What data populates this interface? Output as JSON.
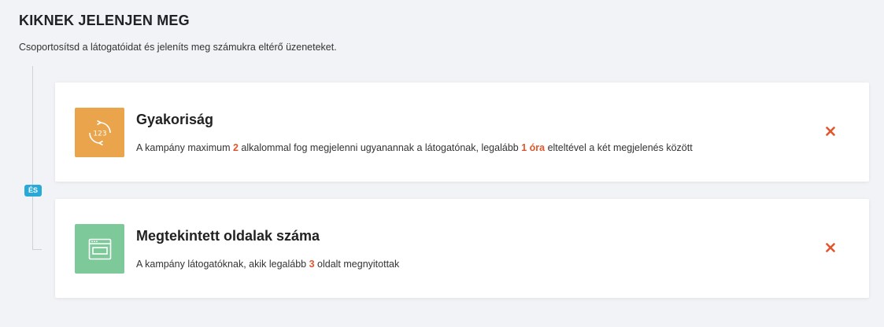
{
  "page": {
    "title": "KIKNEK JELENJEN MEG",
    "subtitle": "Csoportosítsd a látogatóidat és jeleníts meg számukra eltérő üzeneteket."
  },
  "connector": {
    "and_label": "ÉS"
  },
  "colors": {
    "accent": "#e2552d",
    "frequency_icon_bg": "#e9a44c",
    "pageviews_icon_bg": "#7ec99a",
    "and_badge": "#29a9d8"
  },
  "conditions": [
    {
      "title": "Gyakoriság",
      "icon": "frequency-counter-icon",
      "desc_part1": "A kampány maximum ",
      "value1": "2",
      "desc_part2": " alkalommal fog megjelenni ugyanannak a látogatónak, legalább ",
      "value2": "1 óra",
      "desc_part3": " elteltével a két megjelenés között"
    },
    {
      "title": "Megtekintett oldalak száma",
      "icon": "browser-window-icon",
      "desc_part1": "A kampány látogatóknak, akik legalább ",
      "value1": "3",
      "desc_part2": " oldalt megnyitottak"
    }
  ]
}
